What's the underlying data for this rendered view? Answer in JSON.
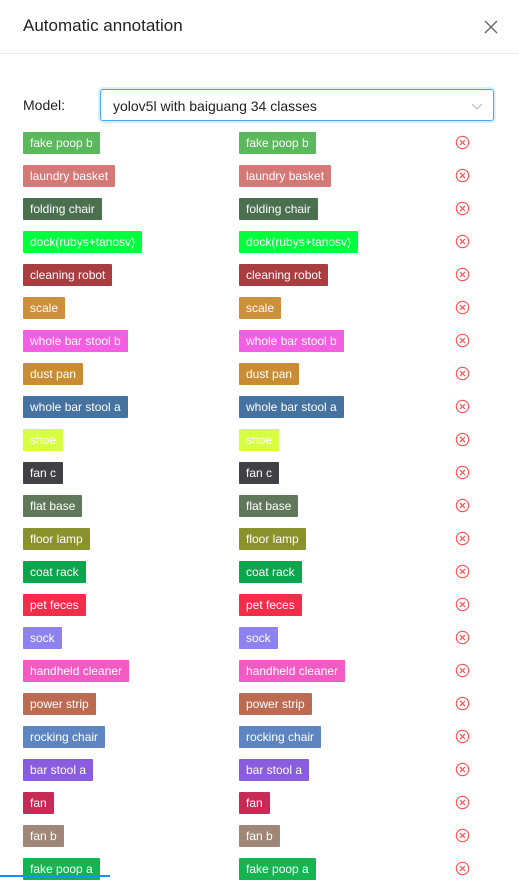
{
  "dialog": {
    "title": "Automatic annotation",
    "close_icon": "close-icon"
  },
  "model": {
    "label": "Model:",
    "selected": "yolov5l with baiguang 34 classes"
  },
  "colors": {
    "accent": "#1890ff",
    "delete": "#ff4d4f"
  },
  "mappings": [
    {
      "source": "fake poop b",
      "target": "fake poop b",
      "color": "#5cb85c"
    },
    {
      "source": "laundry basket",
      "target": "laundry basket",
      "color": "#d47976"
    },
    {
      "source": "folding chair",
      "target": "folding chair",
      "color": "#4a7050"
    },
    {
      "source": "dock(rubys+tanosv)",
      "target": "dock(rubys+tanosv)",
      "color": "#00ff3c"
    },
    {
      "source": "cleaning robot",
      "target": "cleaning robot",
      "color": "#a93d40"
    },
    {
      "source": "scale",
      "target": "scale",
      "color": "#cc8f3a"
    },
    {
      "source": "whole bar stool b",
      "target": "whole bar stool b",
      "color": "#f35ee3"
    },
    {
      "source": "dust pan",
      "target": "dust pan",
      "color": "#c98c32"
    },
    {
      "source": "whole bar stool a",
      "target": "whole bar stool a",
      "color": "#45729f"
    },
    {
      "source": "shoe",
      "target": "shoe",
      "color": "#d6ff42"
    },
    {
      "source": "fan c",
      "target": "fan c",
      "color": "#404045"
    },
    {
      "source": "flat base",
      "target": "flat base",
      "color": "#60775a"
    },
    {
      "source": "floor lamp",
      "target": "floor lamp",
      "color": "#8a922e"
    },
    {
      "source": "coat rack",
      "target": "coat rack",
      "color": "#0ba64b"
    },
    {
      "source": "pet feces",
      "target": "pet feces",
      "color": "#f22d4a"
    },
    {
      "source": "sock",
      "target": "sock",
      "color": "#8d82f0"
    },
    {
      "source": "handheld cleaner",
      "target": "handheld cleaner",
      "color": "#f35bc2"
    },
    {
      "source": "power strip",
      "target": "power strip",
      "color": "#bd6a52"
    },
    {
      "source": "rocking chair",
      "target": "rocking chair",
      "color": "#5c85c2"
    },
    {
      "source": "bar stool a",
      "target": "bar stool a",
      "color": "#8a5de0"
    },
    {
      "source": "fan",
      "target": "fan",
      "color": "#c62a55"
    },
    {
      "source": "fan b",
      "target": "fan b",
      "color": "#a08676"
    },
    {
      "source": "fake poop a",
      "target": "fake poop a",
      "color": "#14b450"
    }
  ]
}
